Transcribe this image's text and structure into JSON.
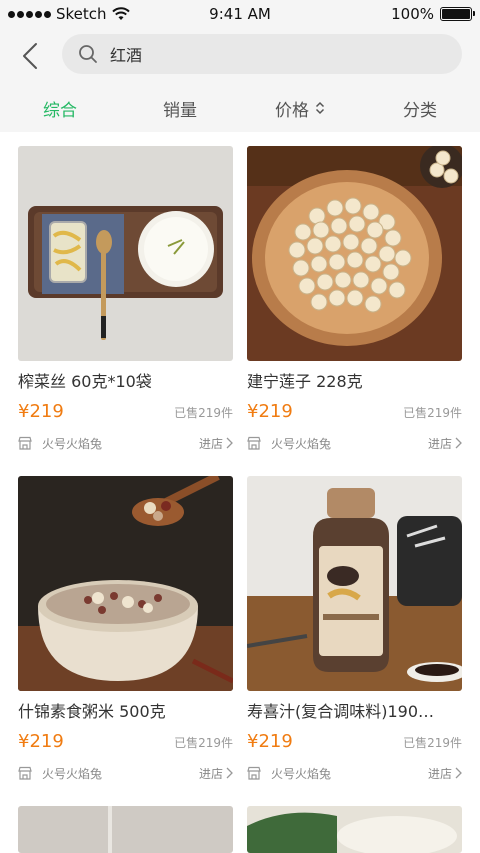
{
  "status_bar": {
    "carrier": "Sketch",
    "time": "9:41 AM",
    "battery": "100%"
  },
  "header": {
    "search_value": "红酒"
  },
  "tabs": [
    {
      "label": "综合",
      "active": true
    },
    {
      "label": "销量"
    },
    {
      "label": "价格"
    },
    {
      "label": "分类"
    }
  ],
  "products": [
    {
      "name": "榨菜丝 60克*10袋",
      "price": "¥219",
      "sold": "已售219件",
      "shop": "火号火焰兔",
      "enter": "进店"
    },
    {
      "name": "建宁莲子 228克",
      "price": "¥219",
      "sold": "已售219件",
      "shop": "火号火焰兔",
      "enter": "进店"
    },
    {
      "name": "什锦素食粥米 500克",
      "price": "¥219",
      "sold": "已售219件",
      "shop": "火号火焰兔",
      "enter": "进店"
    },
    {
      "name": "寿喜汁(复合调味料)190…",
      "price": "¥219",
      "sold": "已售219件",
      "shop": "火号火焰兔",
      "enter": "进店"
    }
  ],
  "colors": {
    "accent": "#25b864",
    "price": "#f07c12"
  }
}
